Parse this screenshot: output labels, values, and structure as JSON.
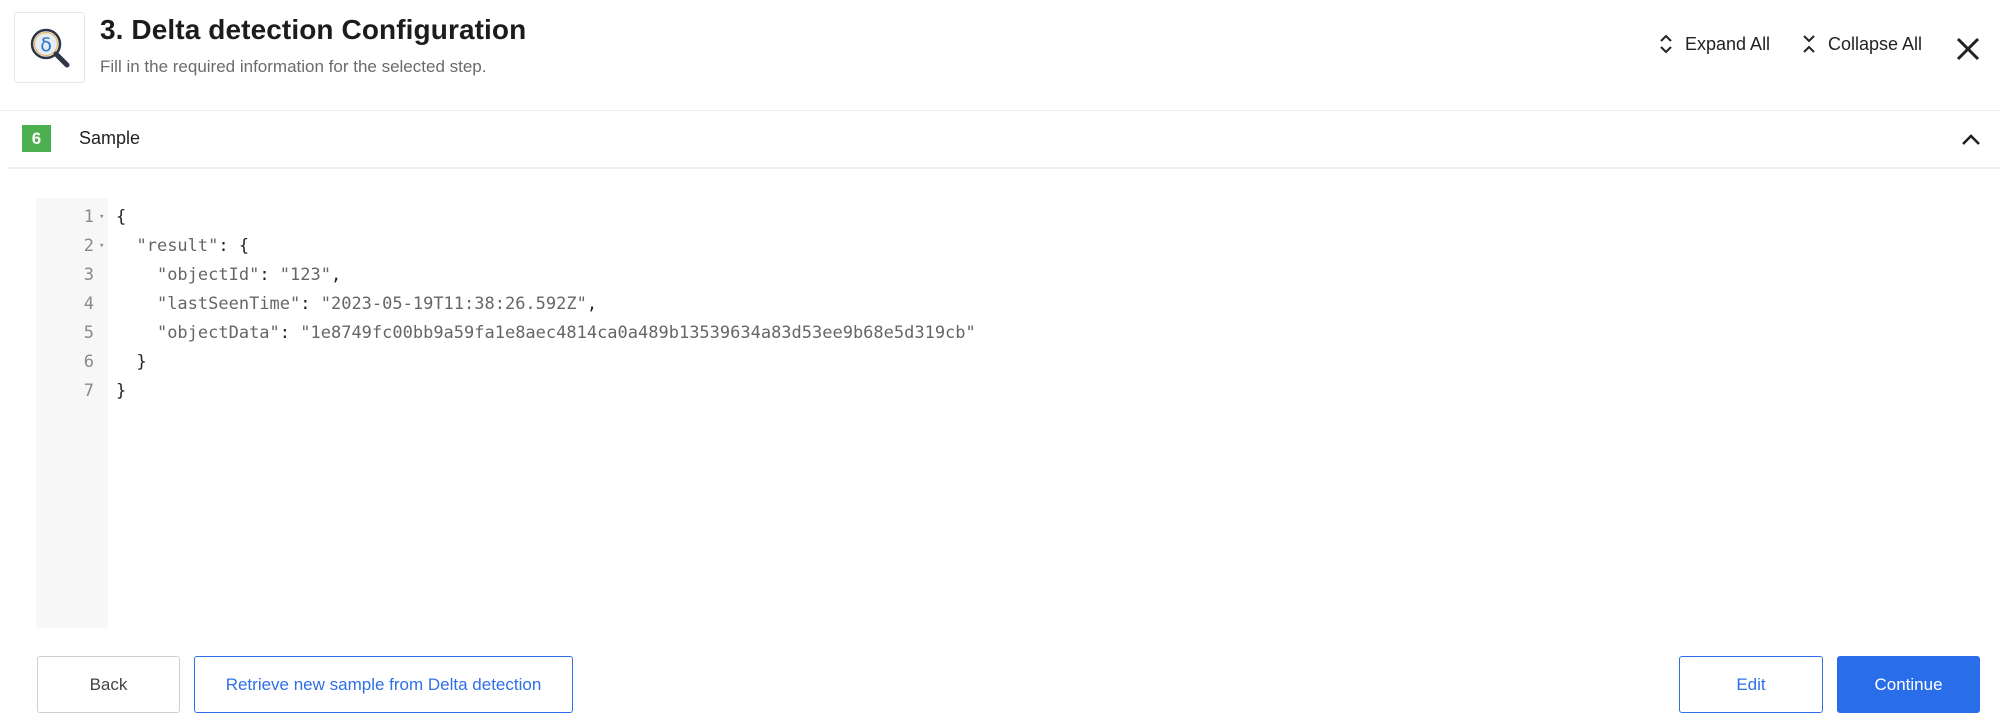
{
  "header": {
    "logo_icon": "delta-magnifier-icon",
    "title": "3. Delta detection Configuration",
    "subtitle": "Fill in the required information for the selected step.",
    "expand_all_label": "Expand All",
    "collapse_all_label": "Collapse All",
    "close_icon": "close-icon"
  },
  "section": {
    "step_number": "6",
    "step_color": "#4caf50",
    "title": "Sample",
    "expanded": true
  },
  "editor": {
    "lines": [
      {
        "num": "1",
        "foldable": true,
        "code": "{"
      },
      {
        "num": "2",
        "foldable": true,
        "code": "  \"result\": {"
      },
      {
        "num": "3",
        "foldable": false,
        "code": "    \"objectId\": \"123\","
      },
      {
        "num": "4",
        "foldable": false,
        "code": "    \"lastSeenTime\": \"2023-05-19T11:38:26.592Z\","
      },
      {
        "num": "5",
        "foldable": false,
        "code": "    \"objectData\": \"1e8749fc00bb9a59fa1e8aec4814ca0a489b13539634a83d53ee9b68e5d319cb\""
      },
      {
        "num": "6",
        "foldable": false,
        "code": "  }"
      },
      {
        "num": "7",
        "foldable": false,
        "code": "}"
      }
    ]
  },
  "footer": {
    "back_label": "Back",
    "retrieve_label": "Retrieve new sample from Delta detection",
    "edit_label": "Edit",
    "continue_label": "Continue",
    "accent_color": "#2a6de8"
  }
}
